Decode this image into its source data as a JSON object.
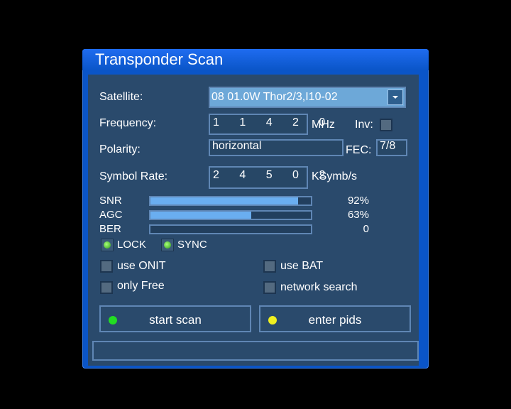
{
  "window": {
    "title": "Transponder Scan"
  },
  "satellite": {
    "label": "Satellite:",
    "value": "08 01.0W Thor2/3,I10-02"
  },
  "frequency": {
    "label": "Frequency:",
    "value": "1 1 4 2 0",
    "unit": "MHz"
  },
  "inversion": {
    "label": "Inv:",
    "checked": false
  },
  "polarity": {
    "label": "Polarity:",
    "value": "horizontal"
  },
  "fec": {
    "label": "FEC:",
    "value": "7/8"
  },
  "symbol_rate": {
    "label": "Symbol Rate:",
    "value": "2 4 5 0 2",
    "unit": "KSymb/s"
  },
  "signal": {
    "snr": {
      "label": "SNR",
      "value_text": "92%",
      "level": 0.92
    },
    "agc": {
      "label": "AGC",
      "value_text": "63%",
      "level": 0.63
    },
    "ber": {
      "label": "BER",
      "value_text": "0",
      "level": 0
    }
  },
  "status": {
    "lock_label": "LOCK",
    "sync_label": "SYNC"
  },
  "options": {
    "use_onit": {
      "label": "use ONIT",
      "checked": false
    },
    "use_bat": {
      "label": "use BAT",
      "checked": false
    },
    "only_free": {
      "label": "only Free",
      "checked": false
    },
    "network_search": {
      "label": "network search",
      "checked": false
    }
  },
  "buttons": {
    "start_scan": {
      "label": "start scan",
      "dot_color": "#22dd22"
    },
    "enter_pids": {
      "label": "enter pids",
      "dot_color": "#f0f020"
    }
  },
  "status_bar": {
    "text": ""
  }
}
